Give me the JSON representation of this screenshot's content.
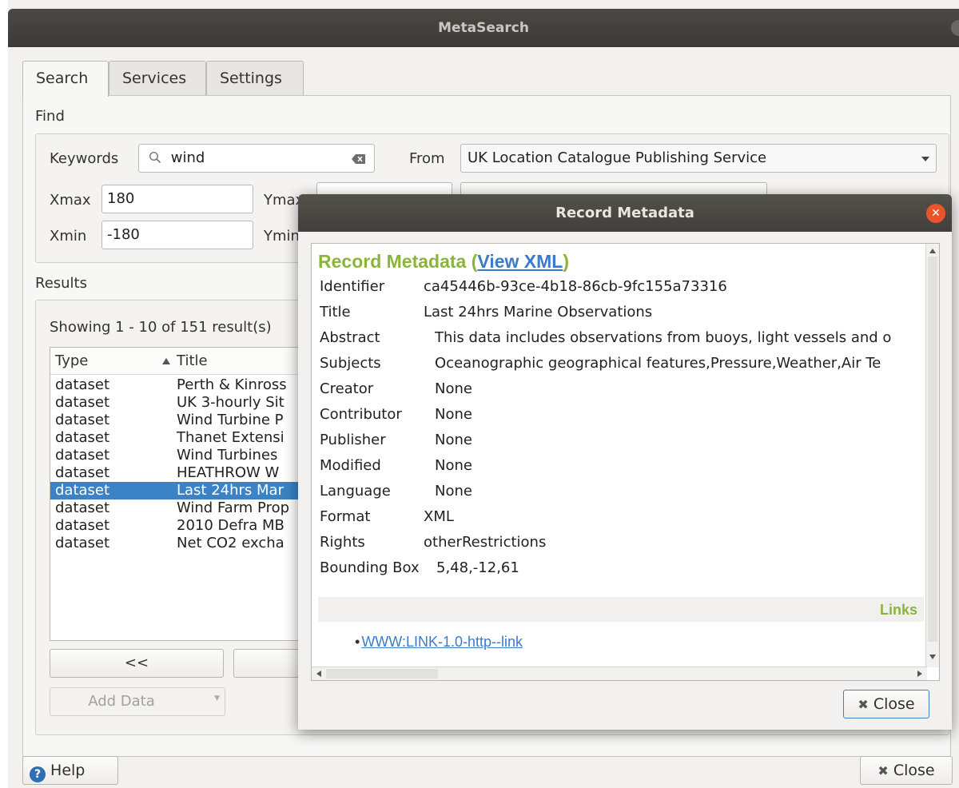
{
  "window": {
    "title": "MetaSearch"
  },
  "tabs": [
    {
      "label": "Search",
      "active": true
    },
    {
      "label": "Services",
      "active": false
    },
    {
      "label": "Settings",
      "active": false
    }
  ],
  "find": {
    "section_label": "Find",
    "keywords_label": "Keywords",
    "keywords_value": "wind",
    "from_label": "From",
    "from_value": "UK Location Catalogue Publishing Service",
    "xmax_label": "Xmax",
    "xmax_value": "180",
    "ymax_label": "Ymax",
    "xmin_label": "Xmin",
    "xmin_value": "-180",
    "ymin_label": "Ymin"
  },
  "results": {
    "section_label": "Results",
    "showing_text": "Showing 1 - 10 of 151 result(s)",
    "columns": [
      "Type",
      "Title"
    ],
    "rows": [
      {
        "type": "dataset",
        "title": "Perth & Kinross",
        "selected": false
      },
      {
        "type": "dataset",
        "title": "UK 3-hourly Sit",
        "selected": false
      },
      {
        "type": "dataset",
        "title": "Wind Turbine P",
        "selected": false
      },
      {
        "type": "dataset",
        "title": "Thanet Extensi",
        "selected": false
      },
      {
        "type": "dataset",
        "title": "Wind Turbines",
        "selected": false
      },
      {
        "type": "dataset",
        "title": "HEATHROW W",
        "selected": false
      },
      {
        "type": "dataset",
        "title": "Last 24hrs Mar",
        "selected": true
      },
      {
        "type": "dataset",
        "title": "Wind Farm Prop",
        "selected": false
      },
      {
        "type": "dataset",
        "title": "2010 Defra MB",
        "selected": false
      },
      {
        "type": "dataset",
        "title": "Net CO2 excha",
        "selected": false
      }
    ],
    "prev_label": "<<",
    "add_data_label": "Add Data"
  },
  "footer": {
    "help_label": "Help",
    "close_label": "Close"
  },
  "dialog": {
    "title": "Record Metadata",
    "heading": "Record Metadata",
    "view_xml_label": "View XML",
    "fields": [
      {
        "key": "Identifier",
        "value": "ca45446b-93ce-4b18-86cb-9fc155a73316"
      },
      {
        "key": "Title",
        "value": "Last 24hrs Marine Observations"
      },
      {
        "key": "Abstract",
        "value": "This data includes observations from buoys, light vessels and o"
      },
      {
        "key": "Subjects",
        "value": "Oceanographic geographical features,Pressure,Weather,Air Te"
      },
      {
        "key": "Creator",
        "value": "None"
      },
      {
        "key": "Contributor",
        "value": "None"
      },
      {
        "key": "Publisher",
        "value": "None"
      },
      {
        "key": "Modified",
        "value": "None"
      },
      {
        "key": "Language",
        "value": "None"
      },
      {
        "key": "Format",
        "value": "XML"
      },
      {
        "key": "Rights",
        "value": "otherRestrictions"
      },
      {
        "key": "Bounding Box",
        "value": "5,48,-12,61"
      }
    ],
    "links_heading": "Links",
    "link_label": "WWW:LINK-1.0-http--link",
    "close_label": "Close"
  }
}
